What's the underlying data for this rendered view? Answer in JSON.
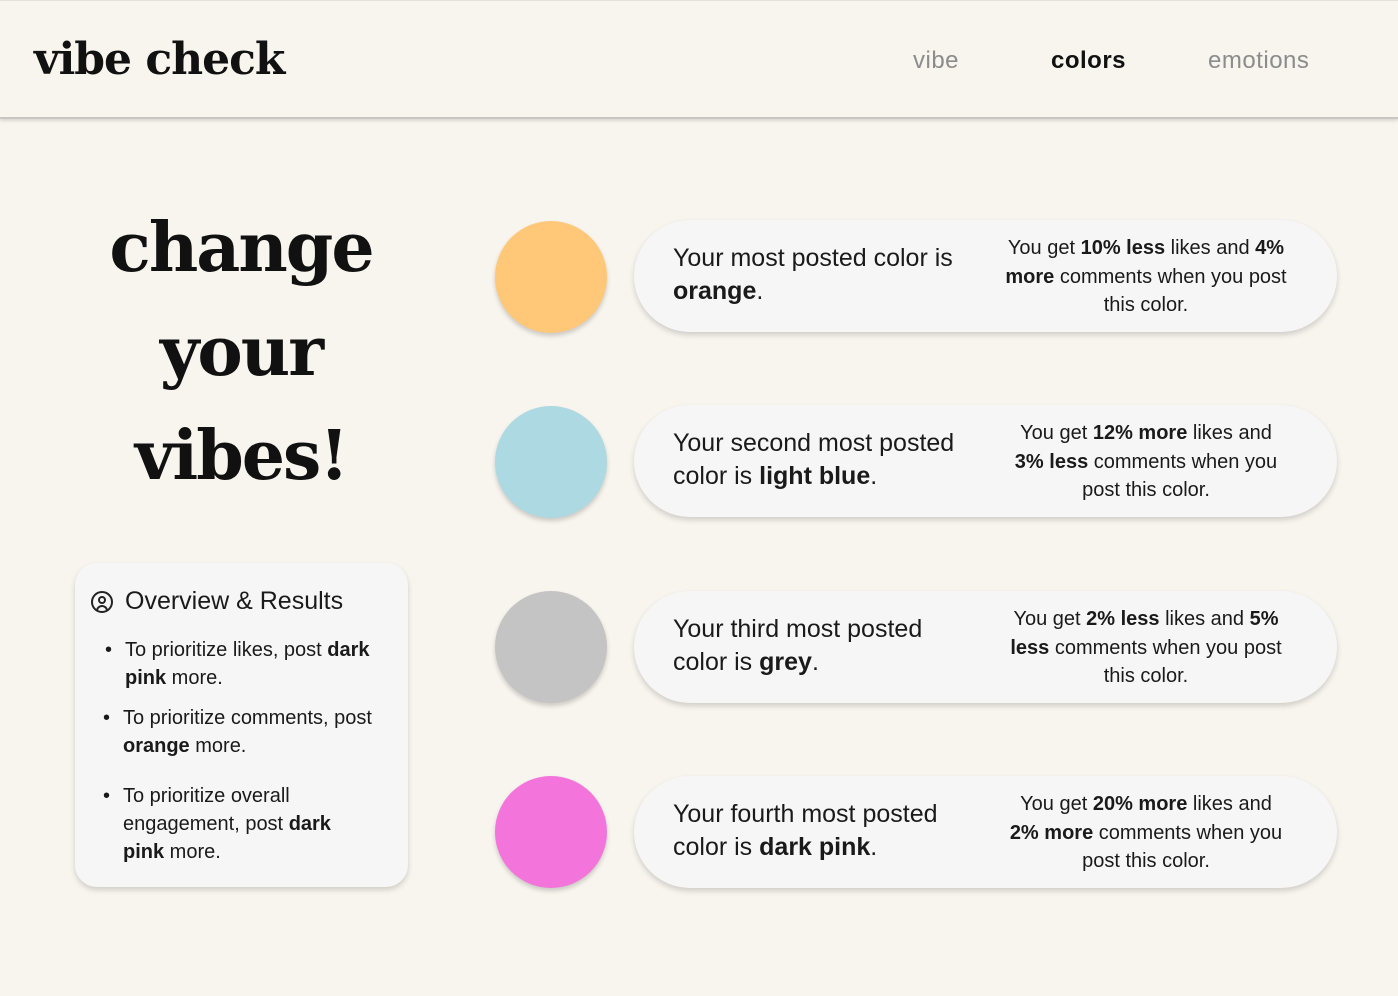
{
  "app": {
    "title": "vibe check"
  },
  "nav": {
    "items": [
      {
        "label": "vibe",
        "active": false
      },
      {
        "label": "colors",
        "active": true
      },
      {
        "label": "emotions",
        "active": false
      }
    ]
  },
  "headline": {
    "lines": [
      "change",
      "your",
      "vibes!"
    ]
  },
  "overview": {
    "title": "Overview & Results",
    "icon": "user-circle-icon",
    "bullets": [
      {
        "pre": "To prioritize likes, post ",
        "bold": "dark pink",
        "post": " more."
      },
      {
        "pre": "To prioritize comments, post ",
        "bold": "orange",
        "post": " more."
      },
      {
        "pre": "To prioritize overall engagement, post ",
        "bold": "dark",
        "bold2": "pink",
        "post": " more."
      }
    ]
  },
  "colors": [
    {
      "swatch": "#ffc878",
      "pre": "Your most posted color is ",
      "color_name": "orange",
      "likes_pct": "10%",
      "likes_dir": "less",
      "comments_pct": "4%",
      "comments_dir": "more"
    },
    {
      "swatch": "#acd9e2",
      "pre": "Your second most posted color is ",
      "color_name": "light blue",
      "likes_pct": "12%",
      "likes_dir": "more",
      "comments_pct": "3%",
      "comments_dir": "less"
    },
    {
      "swatch": "#c4c4c4",
      "pre": "Your third most posted color is ",
      "color_name": "grey",
      "likes_pct": "2%",
      "likes_dir": "less",
      "comments_pct": "5%",
      "comments_dir": "less"
    },
    {
      "swatch": "#f374da",
      "pre": "Your fourth most posted color is ",
      "color_name": "dark pink",
      "likes_pct": "20%",
      "likes_dir": "more",
      "comments_pct": "2%",
      "comments_dir": "more"
    }
  ],
  "theme": {
    "background": "#f8f4ee",
    "card": "#f6f6f6",
    "muted_nav": "#8c8c8c"
  }
}
